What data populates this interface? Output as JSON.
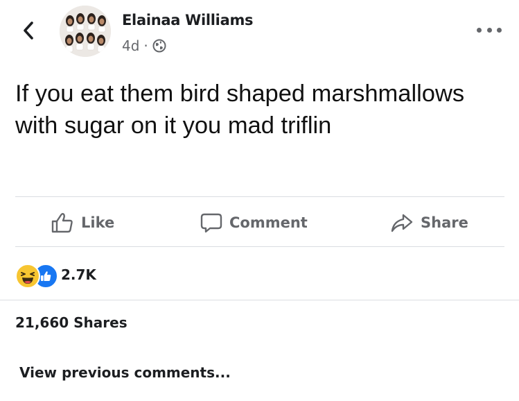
{
  "header": {
    "back_icon": "chevron-left-icon",
    "author_name": "Elainaa Williams",
    "timestamp": "4d",
    "separator": "·",
    "privacy_icon": "globe-icon",
    "more_icon": "more-dots-icon"
  },
  "post": {
    "text": "If you eat them bird shaped marshmallows with sugar on it you mad triflin"
  },
  "actions": {
    "like_label": "Like",
    "like_icon": "thumbs-up-icon",
    "comment_label": "Comment",
    "comment_icon": "speech-bubble-icon",
    "share_label": "Share",
    "share_icon": "share-arrow-icon"
  },
  "reactions": {
    "icons": [
      "haha-reaction-icon",
      "like-reaction-icon"
    ],
    "count": "2.7K"
  },
  "shares": {
    "label": "21,660 Shares"
  },
  "comments": {
    "view_previous_label": "View previous comments..."
  },
  "colors": {
    "text_primary": "#1c1e21",
    "text_secondary": "#65676b",
    "like_blue": "#1877f2",
    "haha_yellow": "#f7c531",
    "divider": "#dadde1"
  }
}
